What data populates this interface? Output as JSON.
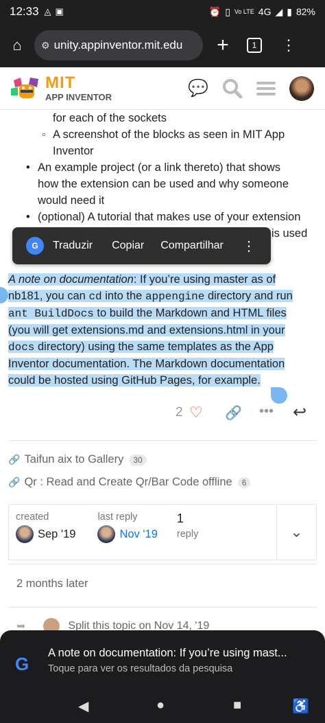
{
  "status": {
    "time": "12:33",
    "battery": "82%",
    "network": "4G"
  },
  "browser": {
    "url": "unity.appinventor.mit.edu",
    "tab_count": "1"
  },
  "site": {
    "logo_top": "MIT",
    "logo_bottom": "APP INVENTOR"
  },
  "post": {
    "sub1": "for each of the sockets",
    "sub2a": "A screenshot of the blocks as seen in MIT App",
    "sub2b": "Inventor",
    "b1a": "An example project (or a link thereto) that shows",
    "b1b": "how the extension can be used and why someone",
    "b1c": "would need it",
    "b2a": "(optional) A tutorial that makes use of your extension",
    "b2b": "is used",
    "p_em": "A note on documentation",
    "p_1": ": If you’re using master as of",
    "p_2": "nb181, you can ",
    "p_cd": "cd",
    "p_3": " into the ",
    "p_appengine": "appengine",
    "p_4": " directory and run",
    "p_ant": "ant BuildDocs",
    "p_5": " to build the Markdown and HTML files",
    "p_6": "(you will get extensions.md and extensions.html in your",
    "p_docs": "docs",
    "p_7": " directory) using the same templates as the App",
    "p_8": "Inventor documentation. The Markdown documentation",
    "p_9": "could be hosted using GitHub Pages, for example."
  },
  "popup": {
    "translate": "Traduzir",
    "copy": "Copiar",
    "share": "Compartilhar"
  },
  "actions": {
    "like_count": "2"
  },
  "links": [
    {
      "title": "Taifun aix to Gallery",
      "count": "30"
    },
    {
      "title": "Qr : Read and Create Qr/Bar Code offline",
      "count": "6"
    }
  ],
  "stats": {
    "created_label": "created",
    "created_value": "Sep '19",
    "last_reply_label": "last reply",
    "last_reply_value": "Nov '19",
    "replies_count": "1",
    "replies_label": "reply"
  },
  "later": "2 months later",
  "small_action": "Split this topic on Nov 14, '19",
  "google": {
    "title": "A note on documentation: If you’re using mast...",
    "subtitle": "Toque para ver os resultados da pesquisa"
  },
  "colors": {
    "selection": "#b8dcf7",
    "link": "#1a73e8",
    "heart": "#e45735"
  }
}
